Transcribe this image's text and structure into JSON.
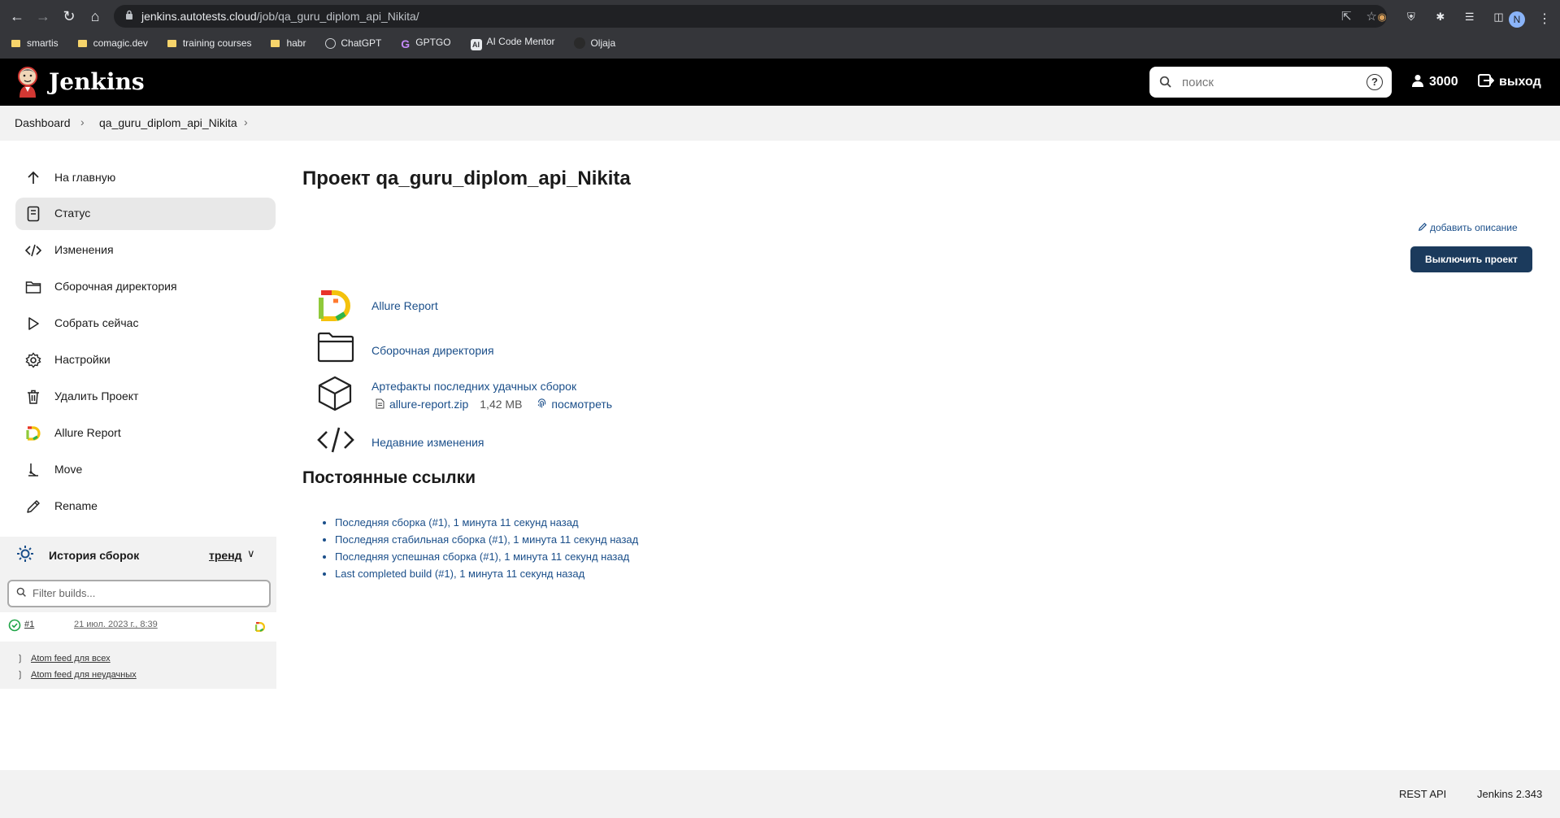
{
  "browser": {
    "url_host": "jenkins.autotests.cloud",
    "url_path": "/job/qa_guru_diplom_api_Nikita/",
    "profile_initial": "N",
    "bookmarks": [
      {
        "label": "smartis",
        "type": "folder"
      },
      {
        "label": "comagic.dev",
        "type": "folder"
      },
      {
        "label": "training courses",
        "type": "folder"
      },
      {
        "label": "habr",
        "type": "folder"
      },
      {
        "label": "ChatGPT",
        "type": "chatgpt"
      },
      {
        "label": "GPTGO",
        "type": "gptgo"
      },
      {
        "label": "AI Code Mentor",
        "type": "ai"
      },
      {
        "label": "Oljaja",
        "type": "dot"
      }
    ]
  },
  "header": {
    "app_name": "Jenkins",
    "search_placeholder": "поиск",
    "help_symbol": "?",
    "user_label": "3000",
    "logout_label": "выход"
  },
  "breadcrumb": {
    "items": [
      "Dashboard",
      "qa_guru_diplom_api_Nikita"
    ]
  },
  "sidebar": {
    "items": [
      {
        "label": "На главную",
        "icon": "arrow-up-icon"
      },
      {
        "label": "Статус",
        "icon": "document-icon",
        "active": true
      },
      {
        "label": "Изменения",
        "icon": "code-icon"
      },
      {
        "label": "Сборочная директория",
        "icon": "folder-icon"
      },
      {
        "label": "Собрать сейчас",
        "icon": "play-icon"
      },
      {
        "label": "Настройки",
        "icon": "gear-icon"
      },
      {
        "label": "Удалить Проект",
        "icon": "trash-icon"
      },
      {
        "label": "Allure Report",
        "icon": "allure-icon"
      },
      {
        "label": "Move",
        "icon": "move-icon"
      },
      {
        "label": "Rename",
        "icon": "pencil-icon"
      }
    ]
  },
  "history": {
    "title": "История сборок",
    "trend_label": "тренд",
    "filter_placeholder": "Filter builds...",
    "builds": [
      {
        "number": "#1",
        "date": "21 июл. 2023 г., 8:39",
        "status": "success"
      }
    ],
    "feeds": [
      "Atom feed для всех",
      "Atom feed для неудачных"
    ]
  },
  "main": {
    "title": "Проект qa_guru_diplom_api_Nikita",
    "add_description": "добавить описание",
    "disable_button": "Выключить проект",
    "links": {
      "allure": "Allure Report",
      "workspace": "Сборочная директория",
      "artifacts": "Артефакты последних удачных сборок",
      "artifact_file": "allure-report.zip",
      "artifact_size": "1,42 MB",
      "artifact_view": "посмотреть",
      "changes": "Недавние изменения"
    },
    "permalinks_title": "Постоянные ссылки",
    "permalinks": [
      "Последняя сборка (#1), 1 минута 11 секунд назад",
      "Последняя стабильная сборка (#1), 1 минута 11 секунд назад",
      "Последняя успешная сборка (#1), 1 минута 11 секунд назад",
      "Last completed build (#1), 1 минута 11 секунд назад"
    ]
  },
  "footer": {
    "rest_api": "REST API",
    "version": "Jenkins 2.343"
  },
  "colors": {
    "link": "#1b4f8a",
    "header_bg": "#000000",
    "button_bg": "#1b3a5c",
    "success": "#1ea446"
  }
}
